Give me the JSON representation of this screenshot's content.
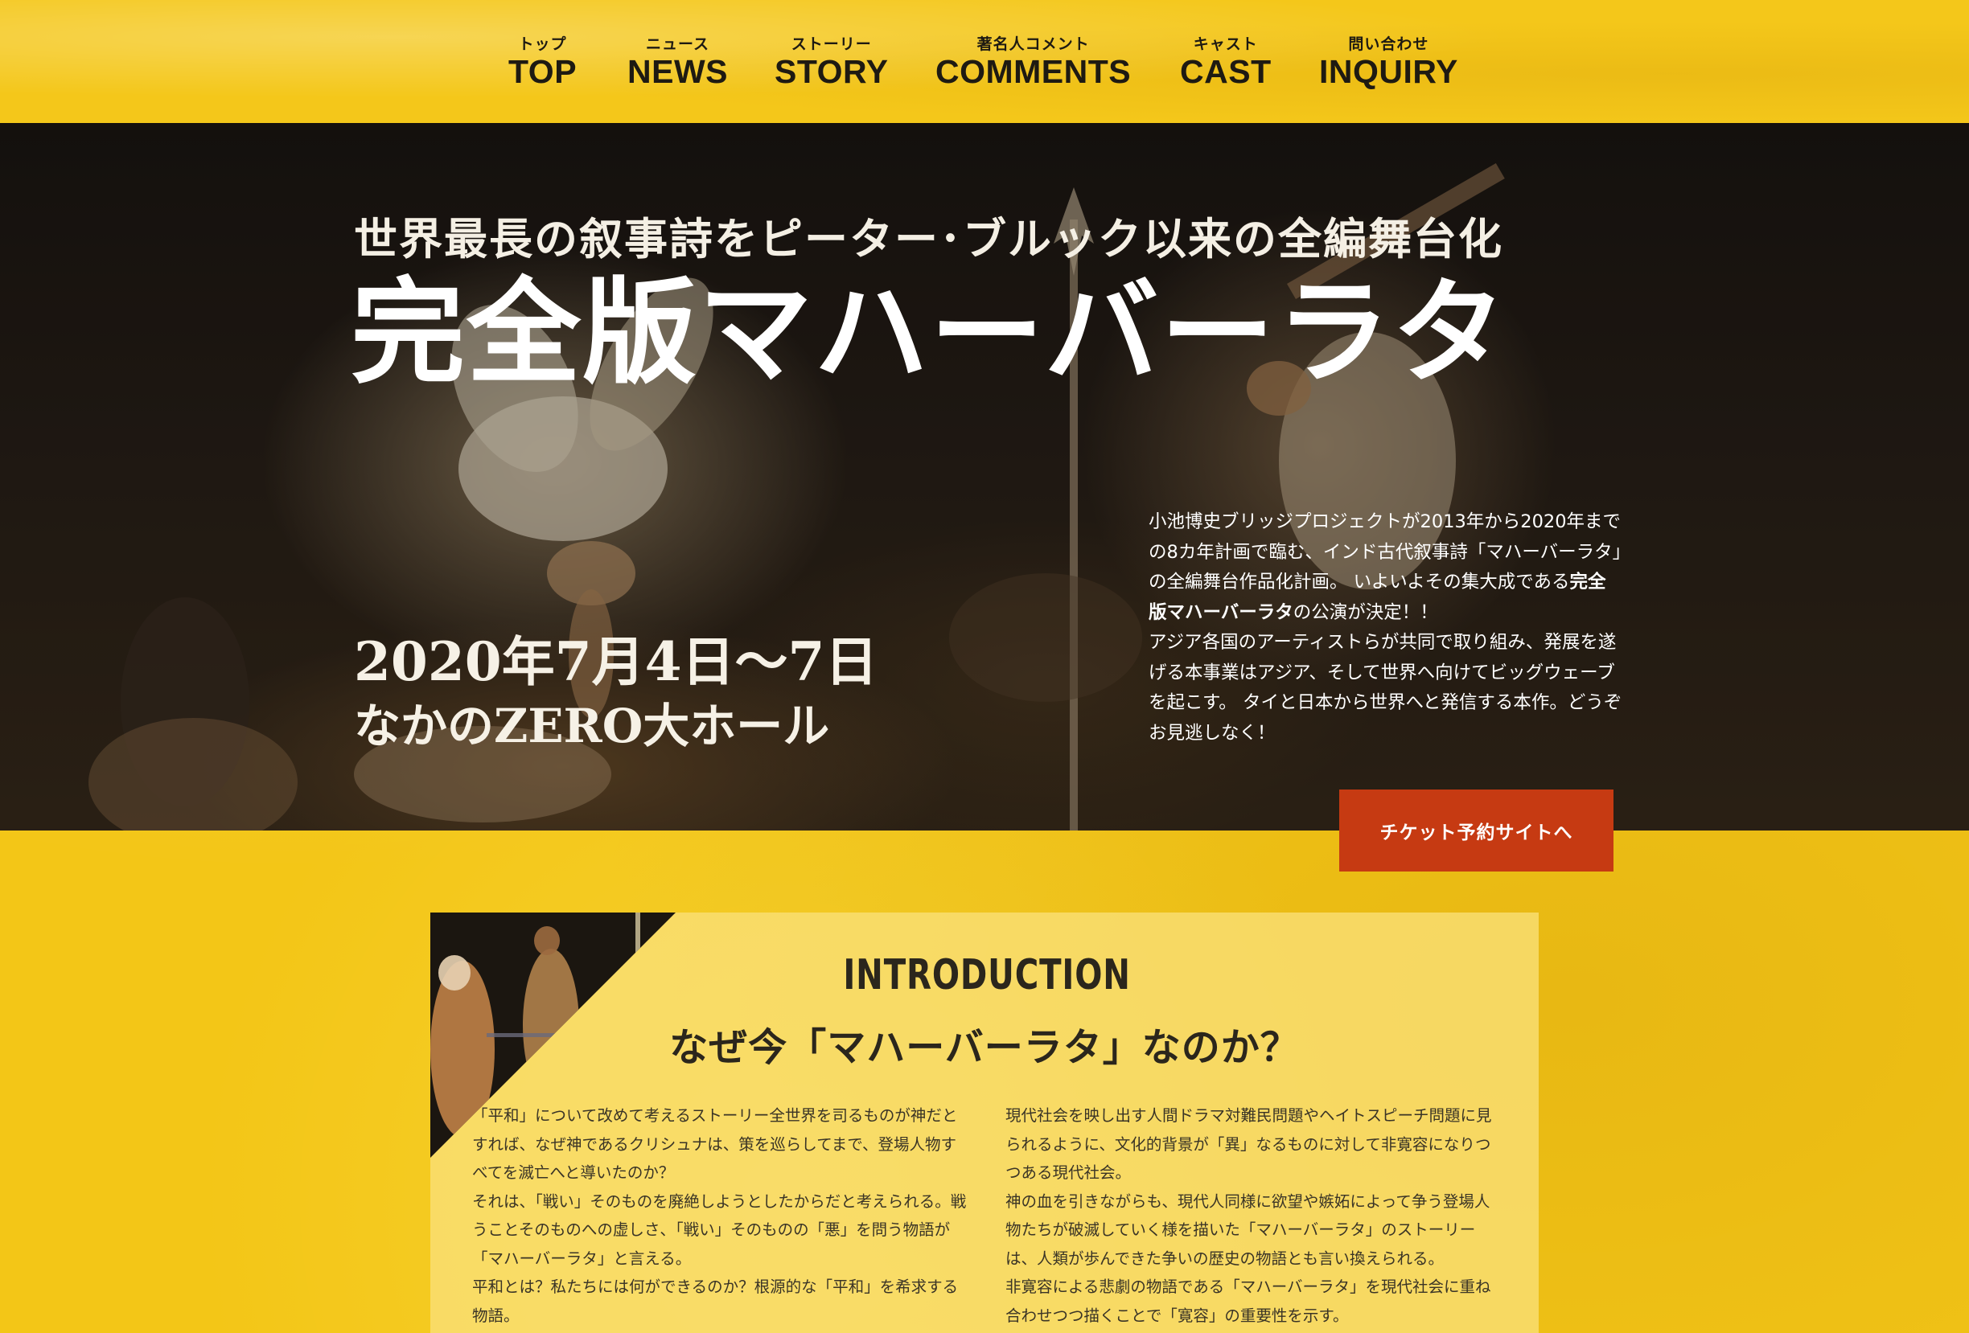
{
  "nav": {
    "items": [
      {
        "jp": "トップ",
        "en": "TOP"
      },
      {
        "jp": "ニュース",
        "en": "NEWS"
      },
      {
        "jp": "ストーリー",
        "en": "STORY"
      },
      {
        "jp": "著名人コメント",
        "en": "COMMENTS"
      },
      {
        "jp": "キャスト",
        "en": "CAST"
      },
      {
        "jp": "問い合わせ",
        "en": "INQUIRY"
      }
    ]
  },
  "hero": {
    "tagline": "世界最長の叙事詩をピーター･ブルック以来の全編舞台化",
    "title": "完全版マハーバーラタ",
    "date": "2020年7月4日～7日",
    "venue": "なかのZERO大ホール",
    "description": {
      "line1_before": "小池博史ブリッジプロジェクトが2013年から2020年までの8カ年計画で臨む、インド古代叙事詩「マハーバーラタ」の全編舞台作品化計画。 いよいよその集大成である",
      "line1_bold": "完全版マハーバーラタ",
      "line1_after": "の公演が決定！！",
      "line2": "アジア各国のアーティストらが共同で取り組み、発展を遂げる本事業はアジア、そして世界へ向けてビッグウェーブを起こす。 タイと日本から世界へと発信する本作。どうぞお見逃しなく！"
    },
    "ticket_button": "チケット予約サイトへ"
  },
  "intro": {
    "heading": "INTRODUCTION",
    "subheading": "なぜ今「マハーバーラタ」なのか？",
    "left_paragraphs": [
      "「平和」について改めて考えるストーリー全世界を司るものが神だとすれば、なぜ神であるクリシュナは、策を巡らしてまで、登場人物すべてを滅亡へと導いたのか？",
      "それは、「戦い」そのものを廃絶しようとしたからだと考えられる。戦うことそのものへの虚しさ、「戦い」そのものの「悪」を問う物語が「マハーバーラタ」と言える。",
      "平和とは？私たちには何ができるのか？根源的な「平和」を希求する物語。"
    ],
    "right_paragraphs": [
      "現代社会を映し出す人間ドラマ対難民問題やヘイトスピーチ問題に見られるように、文化的背景が「異」なるものに対して非寛容になりつつある現代社会。",
      "神の血を引きながらも、現代人同様に欲望や嫉妬によって争う登場人物たちが破滅していく様を描いた「マハーバーラタ」のストーリーは、人類が歩んできた争いの歴史の物語とも言い換えられる。",
      "非寛容による悲劇の物語である「マハーバーラタ」を現代社会に重ね合わせつつ描くことで「寛容」の重要性を示す。"
    ]
  },
  "colors": {
    "background": "#f3c617",
    "nav_text": "#1e1a12",
    "button": "#c63a12",
    "hero_text": "#ffffff"
  }
}
